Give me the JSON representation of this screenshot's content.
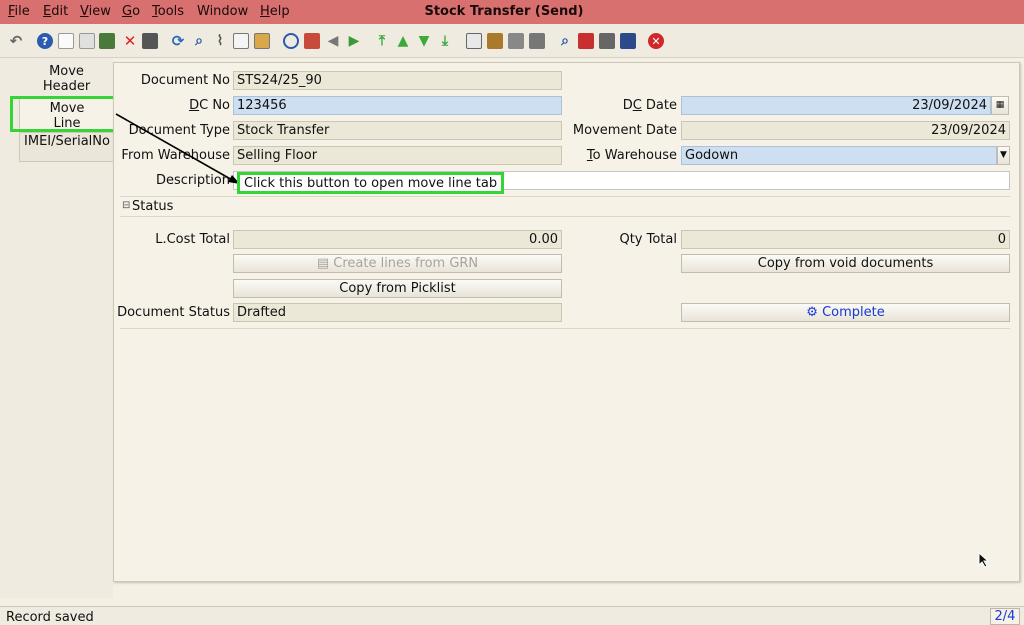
{
  "menu": [
    {
      "label": "File",
      "u": "F",
      "rest": "ile"
    },
    {
      "label": "Edit",
      "u": "E",
      "rest": "dit"
    },
    {
      "label": "View",
      "u": "V",
      "rest": "iew"
    },
    {
      "label": "Go",
      "u": "G",
      "rest": "o"
    },
    {
      "label": "Tools",
      "u": "T",
      "rest": "ools"
    },
    {
      "label": "Window",
      "u": "",
      "rest": "Window"
    },
    {
      "label": "Help",
      "u": "H",
      "rest": "elp"
    }
  ],
  "window_title": "Stock Transfer (Send)",
  "toolbar_icons": [
    "undo-icon",
    "help-icon",
    "new-icon",
    "copy-icon",
    "save-icon",
    "delete-icon",
    "print-icon",
    "refresh-icon",
    "find-icon",
    "attachment-icon",
    "chat-icon",
    "history-icon",
    "home-icon",
    "back-icon",
    "forward-icon",
    "first-record-icon",
    "previous-record-icon",
    "next-record-icon",
    "last-record-icon",
    "report-icon",
    "archive-icon",
    "print-preview-icon",
    "print-icon-2",
    "zoom-across-icon",
    "request-icon",
    "product-info-icon",
    "workflow-icon",
    "exit-icon"
  ],
  "tabs": {
    "move_header": "Move\nHeader",
    "move_header_l1": "Move",
    "move_header_l2": "Header",
    "move_line_l1": "Move",
    "move_line_l2": "Line",
    "imei": "IMEI/SerialNo"
  },
  "form": {
    "document_no_label": "Document No",
    "document_no": "STS24/25_90",
    "dc_no_label": "DC No",
    "dc_no": "123456",
    "dc_date_label": "DC Date",
    "dc_date": "23/09/2024",
    "document_type_label": "Document Type",
    "document_type": "Stock Transfer",
    "movement_date_label": "Movement Date",
    "movement_date": "23/09/2024",
    "from_warehouse_label": "From Warehouse",
    "from_warehouse": "Selling Floor",
    "to_warehouse_label": "To Warehouse",
    "to_warehouse": "Godown",
    "description_label": "Description"
  },
  "status_section": {
    "title": "Status",
    "lcost_total_label": "L.Cost Total",
    "lcost_total": "0.00",
    "qty_total_label": "Qty Total",
    "qty_total": "0",
    "create_lines_btn": "Create lines from GRN",
    "copy_void_btn": "Copy from void documents",
    "copy_picklist_btn": "Copy from Picklist",
    "document_status_label": "Document Status",
    "document_status": "Drafted",
    "complete_btn": "Complete"
  },
  "annotation": {
    "tooltip": "Click this button to open move line tab",
    "highlight_color": "#35d535"
  },
  "statusbar": {
    "message": "Record saved",
    "record_count": "2/4"
  },
  "colors": {
    "titlebar": "#d97070",
    "blue_field": "#cddff0",
    "readonly_field": "#ebe8d8",
    "link_blue": "#1838d8"
  }
}
